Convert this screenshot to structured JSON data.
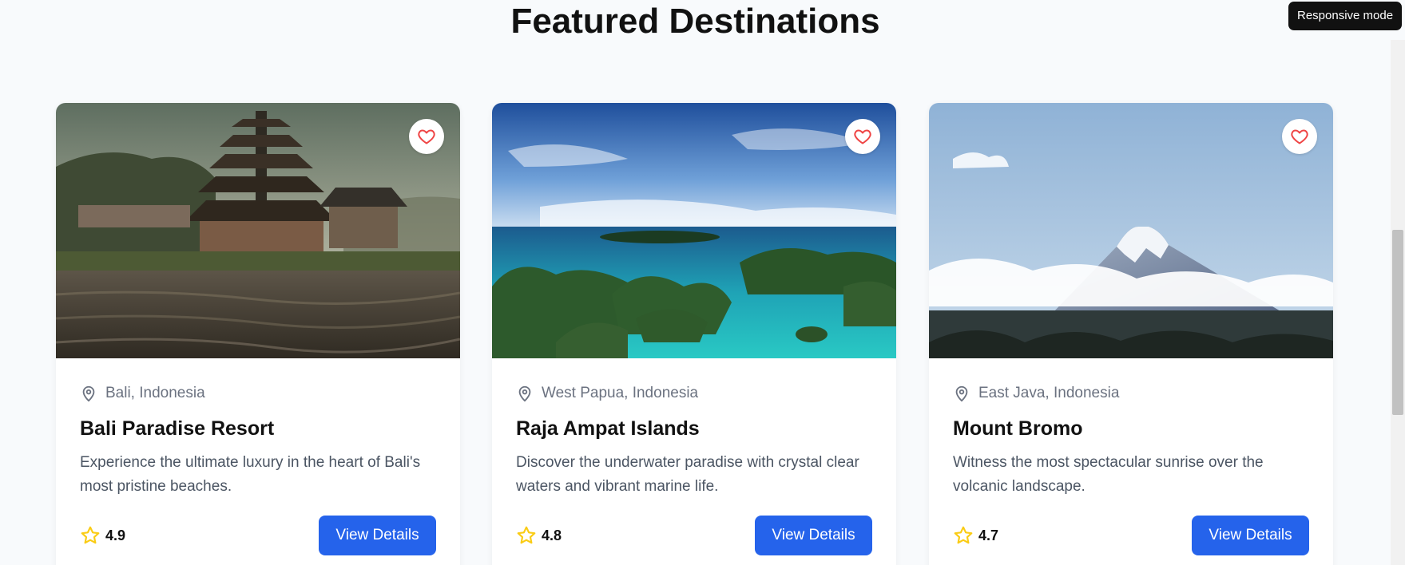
{
  "section": {
    "title": "Featured Destinations"
  },
  "tooltip": {
    "text": "Responsive mode"
  },
  "theme": {
    "accent": "#2563eb",
    "heart": "#ef4444",
    "star": "#facc15"
  },
  "cards": [
    {
      "location": "Bali, Indonesia",
      "title": "Bali Paradise Resort",
      "description": "Experience the ultimate luxury in the heart of Bali's most pristine beaches.",
      "rating": "4.9",
      "button_label": "View Details",
      "image_icon": "temple-lake-photo"
    },
    {
      "location": "West Papua, Indonesia",
      "title": "Raja Ampat Islands",
      "description": "Discover the underwater paradise with crystal clear waters and vibrant marine life.",
      "rating": "4.8",
      "button_label": "View Details",
      "image_icon": "tropical-islands-photo"
    },
    {
      "location": "East Java, Indonesia",
      "title": "Mount Bromo",
      "description": "Witness the most spectacular sunrise over the volcanic landscape.",
      "rating": "4.7",
      "button_label": "View Details",
      "image_icon": "volcano-photo"
    }
  ]
}
